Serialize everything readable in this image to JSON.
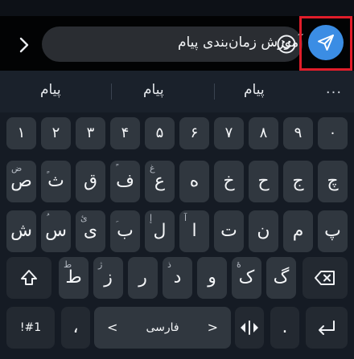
{
  "compose": {
    "message_text": "آموزش زمان‌بندی پیام"
  },
  "colors": {
    "send_button": "#3b8de4",
    "highlight": "#e11d2a",
    "key": "#30373f",
    "function_key": "#232931"
  },
  "icons": {
    "back": "chevron-right-icon",
    "emoji": "smiley-icon",
    "send": "send-plane-icon",
    "shift": "shift-arrow-icon",
    "backspace": "backspace-icon",
    "enter": "enter-icon",
    "cursor": "cursor-move-icon"
  },
  "suggestions": [
    "پیام",
    "پیام",
    "پیام"
  ],
  "more_label": "...",
  "keyboard": {
    "numbers": [
      "۱",
      "۲",
      "۳",
      "۴",
      "۵",
      "۶",
      "۷",
      "۸",
      "۹",
      "۰"
    ],
    "row1": [
      {
        "c": "ص",
        "h": "ض"
      },
      {
        "c": "ث",
        "h": "ٍ"
      },
      {
        "c": "ق",
        "h": ""
      },
      {
        "c": "ف",
        "h": "ً"
      },
      {
        "c": "ع",
        "h": "غ"
      },
      {
        "c": "ه",
        "h": ""
      },
      {
        "c": "خ",
        "h": ""
      },
      {
        "c": "ح",
        "h": ""
      },
      {
        "c": "ج",
        "h": ""
      },
      {
        "c": "چ",
        "h": ""
      }
    ],
    "row2": [
      {
        "c": "ش",
        "h": ""
      },
      {
        "c": "س",
        "h": "ُ"
      },
      {
        "c": "ی",
        "h": "ئ"
      },
      {
        "c": "ب",
        "h": "ِ"
      },
      {
        "c": "ل",
        "h": "إ"
      },
      {
        "c": "ا",
        "h": "آ"
      },
      {
        "c": "ت",
        "h": ""
      },
      {
        "c": "ن",
        "h": ""
      },
      {
        "c": "م",
        "h": ""
      },
      {
        "c": "پ",
        "h": ""
      }
    ],
    "row3": [
      {
        "c": "ظ",
        "h": "ط"
      },
      {
        "c": "ط",
        "h": "ژ"
      },
      {
        "c": "ز",
        "h": ""
      },
      {
        "c": "ر",
        "h": "ذ"
      },
      {
        "c": "د",
        "h": ""
      },
      {
        "c": "و",
        "h": ""
      },
      {
        "c": "ک",
        "h": "ۀ"
      },
      {
        "c": "گ",
        "h": ""
      }
    ],
    "bottom": {
      "symbols_label": "!#1",
      "comma_label": "،",
      "space_label": "فارسی",
      "left_arrow": "<",
      "right_arrow": ">",
      "period_label": "."
    }
  }
}
